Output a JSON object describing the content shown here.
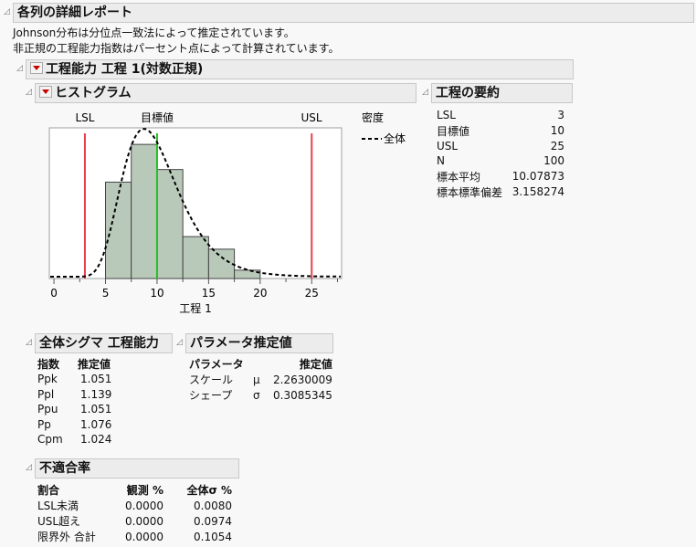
{
  "report": {
    "title": "各列の詳細レポート",
    "note1": "Johnson分布は分位点一致法によって推定されています。",
    "note2": "非正規の工程能力指数はパーセント点によって計算されています。"
  },
  "capability": {
    "title": "工程能力 工程 1(対数正規)"
  },
  "histogram": {
    "title": "ヒストグラム",
    "lsl_label": "LSL",
    "target_label": "目標値",
    "usl_label": "USL",
    "legend_title": "密度",
    "legend_item": "全体"
  },
  "chart_data": {
    "type": "bar",
    "xlabel": "工程 1",
    "xlim": [
      -0.45,
      27.9
    ],
    "xticks": [
      0,
      5,
      10,
      15,
      20,
      25
    ],
    "bins": [
      [
        5,
        7.5
      ],
      [
        7.5,
        10
      ],
      [
        10,
        12.5
      ],
      [
        12.5,
        15
      ],
      [
        15,
        17.5
      ],
      [
        17.5,
        20
      ]
    ],
    "counts": [
      23,
      32,
      26,
      10,
      7,
      2
    ],
    "lsl": 3,
    "target": 10,
    "usl": 25,
    "density": {
      "dist": "lognormal",
      "mu": 2.2630009,
      "sigma": 0.3085345,
      "n": 100
    },
    "colors": {
      "bar": "#b9c9b9",
      "spec": "#e8404c",
      "target": "#22c022"
    }
  },
  "summary": {
    "title": "工程の要約",
    "rows": [
      {
        "label": "LSL",
        "value": "3"
      },
      {
        "label": "目標値",
        "value": "10"
      },
      {
        "label": "USL",
        "value": "25"
      },
      {
        "label": "N",
        "value": "100"
      },
      {
        "label": "標本平均",
        "value": "10.07873"
      },
      {
        "label": "標本標準偏差",
        "value": "3.158274"
      }
    ]
  },
  "sigma": {
    "title": "全体シグマ 工程能力",
    "col1": "指数",
    "col2": "推定値",
    "rows": [
      {
        "label": "Ppk",
        "value": "1.051"
      },
      {
        "label": "Ppl",
        "value": "1.139"
      },
      {
        "label": "Ppu",
        "value": "1.051"
      },
      {
        "label": "Pp",
        "value": "1.076"
      },
      {
        "label": "Cpm",
        "value": "1.024"
      }
    ]
  },
  "params": {
    "title": "パラメータ推定値",
    "col1": "パラメータ",
    "col2": "推定値",
    "rows": [
      {
        "label": "スケール",
        "sym": "μ",
        "value": "2.2630009"
      },
      {
        "label": "シェープ",
        "sym": "σ",
        "value": "0.3085345"
      }
    ]
  },
  "nonconf": {
    "title": "不適合率",
    "col1": "割合",
    "col2": "観測 %",
    "col3": "全体σ %",
    "rows": [
      {
        "label": "LSL未満",
        "obs": "0.0000",
        "sig": "0.0080"
      },
      {
        "label": "USL超え",
        "obs": "0.0000",
        "sig": "0.0974"
      },
      {
        "label": "限界外 合計",
        "obs": "0.0000",
        "sig": "0.1054"
      }
    ]
  }
}
